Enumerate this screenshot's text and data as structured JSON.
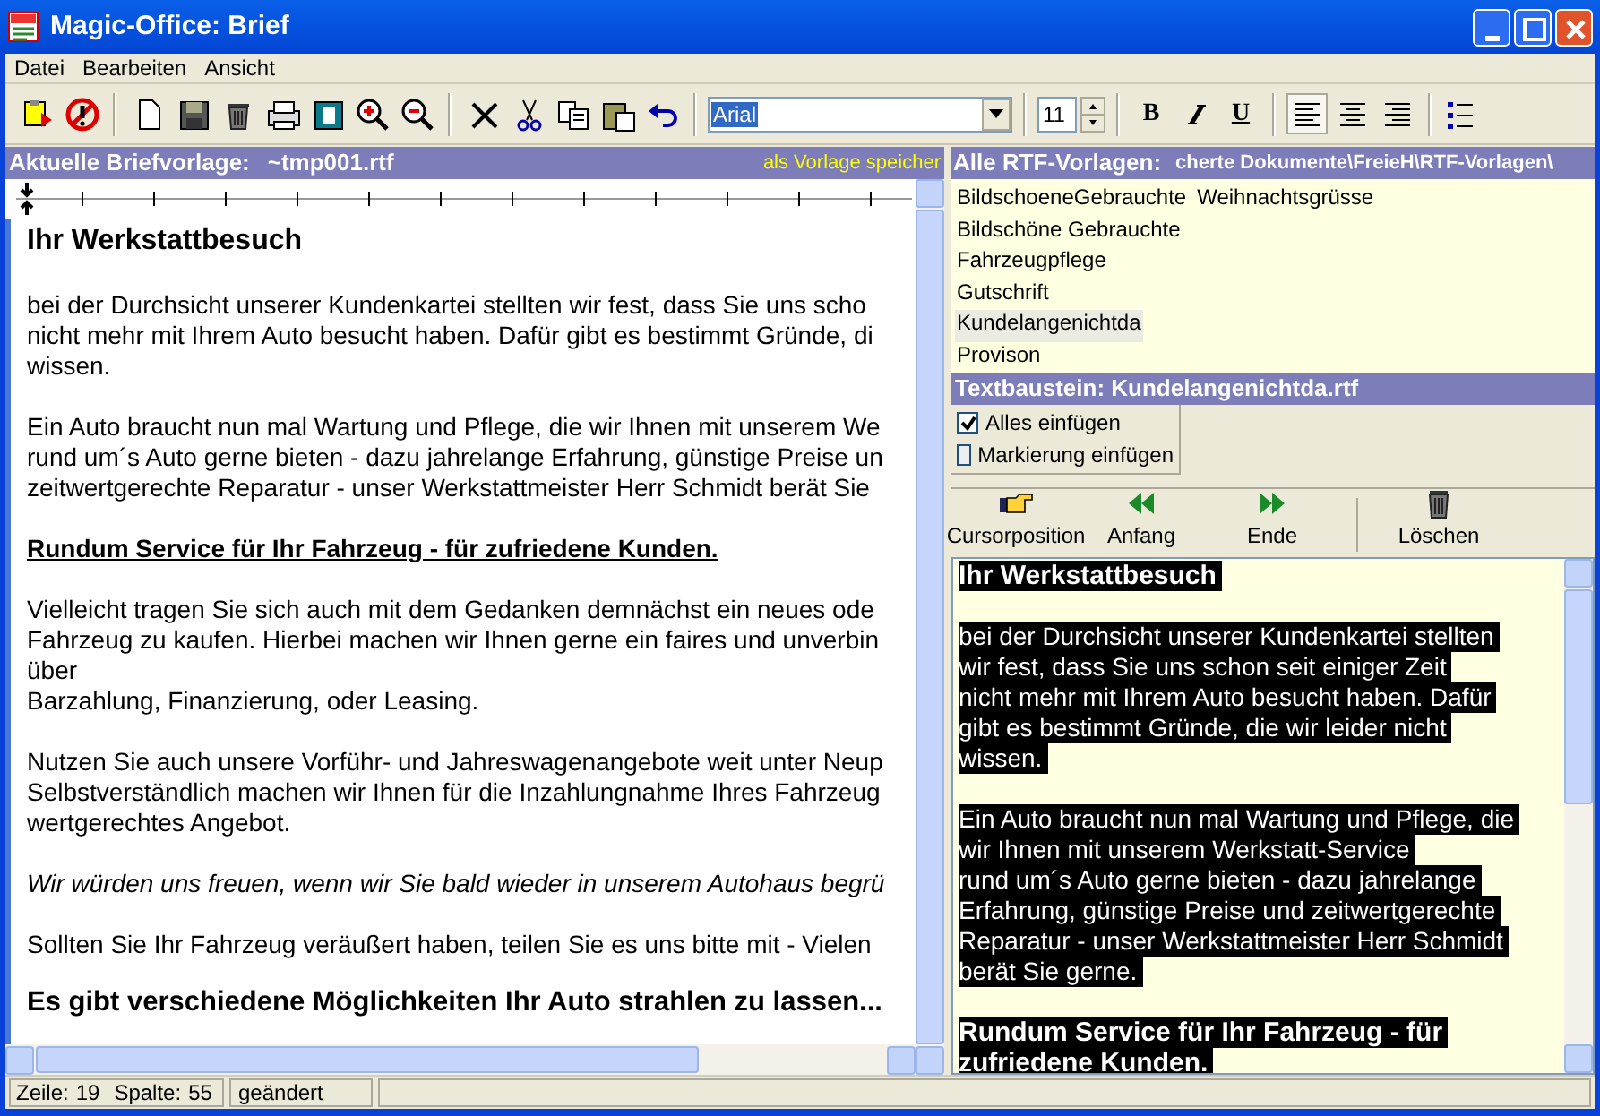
{
  "window": {
    "title": "Magic-Office: Brief"
  },
  "menu": [
    {
      "label": "Datei"
    },
    {
      "label": "Bearbeiten"
    },
    {
      "label": "Ansicht"
    }
  ],
  "toolbar": {
    "groups": [
      [
        {
          "kind": "template"
        },
        {
          "kind": "cancel"
        }
      ],
      [
        {
          "kind": "new"
        },
        {
          "kind": "save"
        },
        {
          "kind": "trash"
        },
        {
          "kind": "print"
        },
        {
          "kind": "preview"
        },
        {
          "kind": "zoomin"
        },
        {
          "kind": "zoomout"
        }
      ],
      [
        {
          "kind": "close"
        },
        {
          "kind": "cut"
        },
        {
          "kind": "copy"
        },
        {
          "kind": "paste"
        },
        {
          "kind": "undo"
        }
      ]
    ],
    "font": "Arial",
    "size": "11",
    "format": [
      {
        "kind": "bold",
        "label": "B"
      },
      {
        "kind": "italic"
      },
      {
        "kind": "underline",
        "label": "U"
      }
    ],
    "align": [
      {
        "kind": "left",
        "selected": true
      },
      {
        "kind": "center",
        "selected": false
      },
      {
        "kind": "right",
        "selected": false
      }
    ],
    "list_button": {
      "kind": "bullets"
    }
  },
  "left_header": {
    "label": "Aktuelle Briefvorlage:",
    "file": "~tmp001.rtf",
    "action": "als Vorlage speicher"
  },
  "editor": [
    {
      "kind": "heading",
      "lines": [
        "Ihr Werkstattbesuch"
      ]
    },
    {
      "kind": "body",
      "lines": [
        "bei der Durchsicht unserer Kundenkartei stellten wir fest, dass Sie uns scho",
        "nicht mehr mit Ihrem Auto besucht haben. Dafür gibt es bestimmt Gründe, di",
        "wissen."
      ]
    },
    {
      "kind": "body",
      "lines": [
        "Ein Auto braucht nun mal Wartung und Pflege, die wir Ihnen mit unserem We",
        "rund um´s Auto gerne bieten - dazu jahrelange Erfahrung, günstige Preise un",
        "zeitwertgerechte Reparatur - unser Werkstattmeister Herr Schmidt berät Sie"
      ]
    },
    {
      "kind": "underline",
      "lines": [
        "Rundum Service für Ihr Fahrzeug - für zufriedene Kunden."
      ]
    },
    {
      "kind": "body",
      "lines": [
        "Vielleicht tragen Sie sich auch mit dem Gedanken demnächst ein neues ode",
        "Fahrzeug zu kaufen. Hierbei machen wir Ihnen gerne ein faires und unverbin",
        "über",
        "Barzahlung, Finanzierung, oder Leasing."
      ]
    },
    {
      "kind": "body",
      "lines": [
        "Nutzen Sie auch unsere Vorführ- und Jahreswagenangebote weit unter Neup",
        "Selbstverständlich machen wir Ihnen für die Inzahlungnahme Ihres Fahrzeug",
        "wertgerechtes Angebot."
      ]
    },
    {
      "kind": "italic",
      "lines": [
        "Wir würden uns freuen, wenn wir Sie bald wieder in unserem Autohaus begrü"
      ]
    },
    {
      "kind": "body",
      "lines": [
        "Sollten Sie Ihr Fahrzeug veräußert haben, teilen Sie es uns bitte mit - Vielen"
      ]
    },
    {
      "kind": "bigheading",
      "lines": [
        "Es gibt verschiedene Möglichkeiten Ihr Auto strahlen zu lassen..."
      ]
    }
  ],
  "right_header": {
    "label": "Alle RTF-Vorlagen:",
    "path": "cherte Dokumente\\FreieH\\RTF-Vorlagen\\"
  },
  "templates": [
    {
      "label": "BildschoeneGebrauchte",
      "selected": false
    },
    {
      "label": "Bildschöne Gebrauchte",
      "selected": false
    },
    {
      "label": "Fahrzeugpflege",
      "selected": false
    },
    {
      "label": "Gutschrift",
      "selected": false
    },
    {
      "label": "Kundelangenichtda",
      "selected": true
    },
    {
      "label": "Provison",
      "selected": false
    },
    {
      "label": "Weihnachtsgrüsse",
      "selected": false
    }
  ],
  "snippet_header": "Textbaustein: Kundelangenichtda.rtf",
  "options": [
    {
      "label": "Alles einfügen",
      "checked": true
    },
    {
      "label": "Markierung einfügen",
      "checked": false
    }
  ],
  "snippet_buttons": [
    {
      "kind": "hand",
      "label": "Cursorposition"
    },
    {
      "kind": "start",
      "label": "Anfang"
    },
    {
      "kind": "end",
      "label": "Ende"
    },
    {
      "kind": "trash",
      "label": "Löschen"
    }
  ],
  "preview": [
    {
      "kind": "heading",
      "lines": [
        "Ihr Werkstattbesuch"
      ]
    },
    {
      "kind": "body",
      "lines": [
        "bei der Durchsicht unserer Kundenkartei stellten",
        "wir fest, dass Sie uns schon seit einiger Zeit",
        "nicht mehr mit Ihrem Auto besucht haben. Dafür",
        "gibt es bestimmt Gründe, die wir leider nicht",
        "wissen."
      ]
    },
    {
      "kind": "body",
      "lines": [
        "Ein Auto braucht nun mal Wartung und Pflege, die",
        "wir Ihnen mit unserem Werkstatt-Service",
        "rund um´s Auto gerne bieten - dazu jahrelange",
        "Erfahrung, günstige Preise und zeitwertgerechte",
        "Reparatur - unser Werkstattmeister Herr Schmidt",
        "berät Sie gerne."
      ]
    },
    {
      "kind": "heading",
      "lines": [
        "Rundum Service für Ihr Fahrzeug - für",
        "zufriedene Kunden."
      ]
    }
  ],
  "status_bar": [
    {
      "label": "Zeile:",
      "value": "19"
    },
    {
      "label": "Spalte:",
      "value": "55"
    },
    {
      "label": "geändert"
    }
  ]
}
